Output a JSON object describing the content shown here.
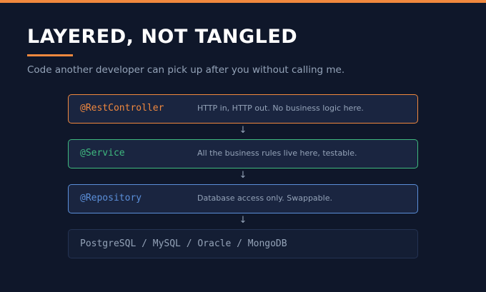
{
  "header": {
    "title": "LAYERED, NOT TANGLED",
    "subtitle": "Code another developer can pick up after you without calling me."
  },
  "colors": {
    "accent": "#f0883e",
    "controller": "#f0883e",
    "service": "#3fb97f",
    "repository": "#5b8fd9"
  },
  "layers": [
    {
      "name": "@RestController",
      "description": "HTTP in, HTTP out. No business logic here."
    },
    {
      "name": "@Service",
      "description": "All the business rules live here, testable."
    },
    {
      "name": "@Repository",
      "description": "Database access only. Swappable."
    }
  ],
  "arrow_glyph": "↓",
  "database": {
    "label": "PostgreSQL / MySQL / Oracle / MongoDB"
  }
}
